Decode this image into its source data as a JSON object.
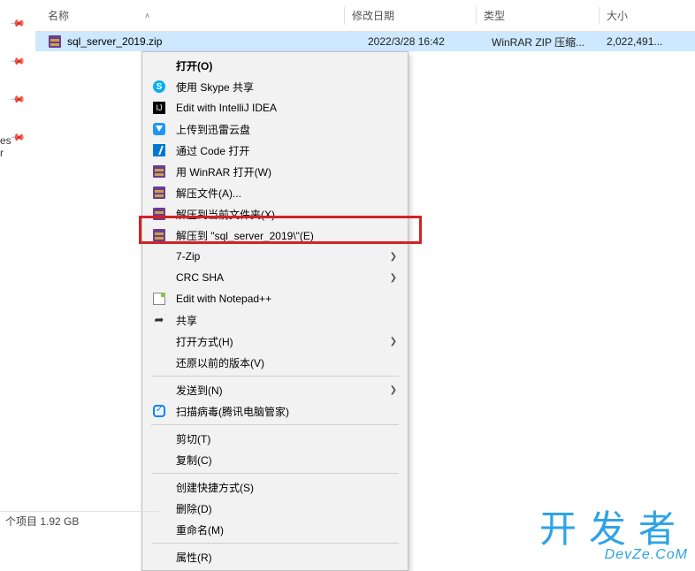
{
  "columns": {
    "name": "名称",
    "modified": "修改日期",
    "type": "类型",
    "size": "大小"
  },
  "file": {
    "name": "sql_server_2019.zip",
    "modified": "2022/3/28 16:42",
    "type": "WinRAR ZIP 压缩...",
    "size": "2,022,491..."
  },
  "context_menu": {
    "open": "打开(O)",
    "skype": "使用 Skype 共享",
    "intellij": "Edit with IntelliJ IDEA",
    "xunlei": "上传到迅雷云盘",
    "code": "通过 Code 打开",
    "winrar_open": "用 WinRAR 打开(W)",
    "extract_files": "解压文件(A)...",
    "extract_here": "解压到当前文件夹(X)",
    "extract_to_folder": "解压到 \"sql_server_2019\\\"(E)",
    "sevenzip": "7-Zip",
    "crc": "CRC SHA",
    "notepad": "Edit with Notepad++",
    "share": "共享",
    "open_with": "打开方式(H)",
    "restore": "还原以前的版本(V)",
    "send_to": "发送到(N)",
    "scan": "扫描病毒(腾讯电脑管家)",
    "cut": "剪切(T)",
    "copy": "复制(C)",
    "shortcut": "创建快捷方式(S)",
    "delete": "删除(D)",
    "rename": "重命名(M)",
    "properties": "属性(R)"
  },
  "status_bar": {
    "text": "个项目  1.92 GB"
  },
  "left_sidebar_hint": {
    "es": "es",
    "r": "r"
  },
  "watermark": {
    "chinese": "开发者",
    "english": "DevZe.CoM"
  }
}
